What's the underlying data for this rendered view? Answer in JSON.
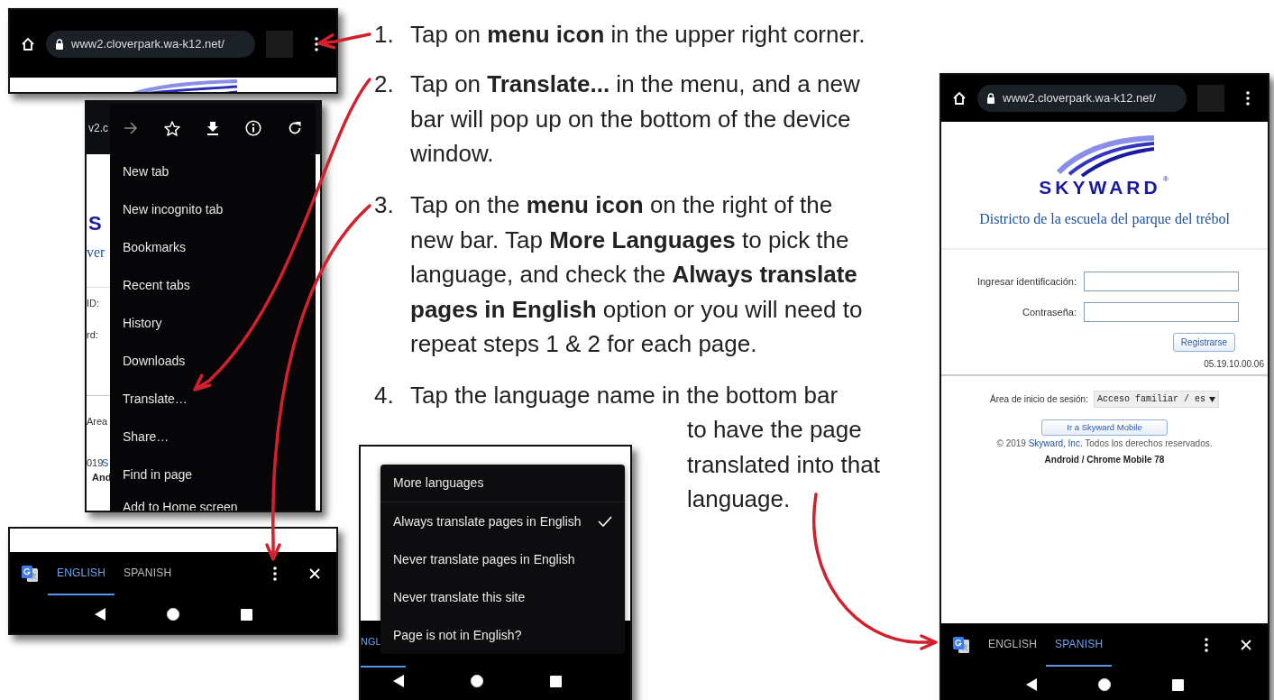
{
  "address_bar": {
    "url": "www2.cloverpark.wa-k12.net/"
  },
  "browser_menu": {
    "url_fragment": "v2.c",
    "page_fragments": [
      {
        "text": "S",
        "kind": "logo"
      },
      {
        "text": "ver",
        "kind": "title"
      },
      {
        "text": "ID:",
        "kind": "label"
      },
      {
        "text": "rd:",
        "kind": "label"
      },
      {
        "text": "Area",
        "kind": "label"
      },
      {
        "text": "019",
        "kind": "label"
      },
      {
        "text": "S",
        "kind": "link"
      },
      {
        "text": "And",
        "kind": "bold"
      }
    ],
    "items": [
      "New tab",
      "New incognito tab",
      "Bookmarks",
      "Recent tabs",
      "History",
      "Downloads",
      "Translate…",
      "Share…",
      "Find in page",
      "Add to Home screen"
    ]
  },
  "translate_bar": {
    "tabs": [
      {
        "label": "ENGLISH",
        "selected": true
      },
      {
        "label": "SPANISH",
        "selected": false
      }
    ]
  },
  "translate_options": {
    "tab_fragment": "NGL",
    "items": [
      {
        "label": "More languages",
        "checked": false
      },
      {
        "label": "Always translate pages in English",
        "checked": true
      },
      {
        "label": "Never translate pages in English",
        "checked": false
      },
      {
        "label": "Never translate this site",
        "checked": false
      },
      {
        "label": "Page is not in English?",
        "checked": false
      }
    ]
  },
  "steps": [
    {
      "number": "1.",
      "text": "Tap on **menu icon** in the upper right corner."
    },
    {
      "number": "2.",
      "text": "Tap on **Translate...** in the menu, and a new bar will pop up on the bottom of the device window."
    },
    {
      "number": "3.",
      "text": "Tap on the **menu icon** on the right of the new bar. Tap **More Languages** to pick the language, and check the **Always translate pages in English** option or you will need to repeat steps 1 & 2 for each page."
    },
    {
      "number": "4.",
      "text": "Tap the language name in the bottom bar",
      "continuation": "to have the page translated into that language."
    }
  ],
  "skyward_page": {
    "url": "www2.cloverpark.wa-k12.net/",
    "logo_text": "SKYWARD",
    "logo_mark": "®",
    "title": "Districto de la escuela del parque del trébol",
    "fields": [
      {
        "label": "Ingresar identificación:"
      },
      {
        "label": "Contraseña:"
      }
    ],
    "submit": "Registrarse",
    "version": "05.19.10.00.06",
    "area_label": "Área de inicio de sesión:",
    "area_value": "Acceso familiar / es",
    "mobile_button": "Ir a Skyward Mobile",
    "copyright_prefix": "© 2019",
    "copyright_link": "Skyward, Inc.",
    "copyright_suffix": "Todos los derechos reservados.",
    "platform": "Android / Chrome Mobile 78",
    "translate_tabs": [
      {
        "label": "ENGLISH",
        "selected": false
      },
      {
        "label": "SPANISH",
        "selected": true
      }
    ]
  }
}
